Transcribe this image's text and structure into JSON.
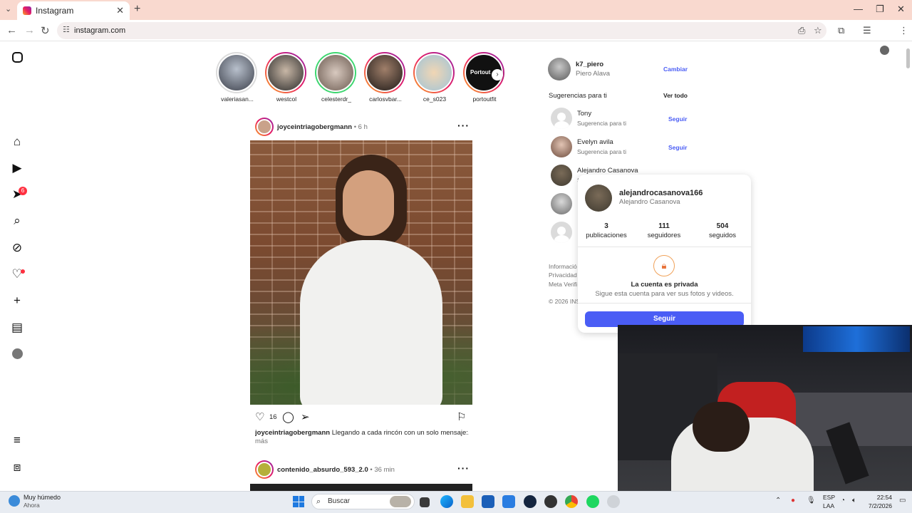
{
  "browser": {
    "tab_title": "Instagram",
    "url": "instagram.com"
  },
  "stories": [
    {
      "label": "valeriasan..."
    },
    {
      "label": "westcol"
    },
    {
      "label": "celesterdr_"
    },
    {
      "label": "carlosvbar..."
    },
    {
      "label": "ce_s023"
    },
    {
      "label": "portoutfit"
    }
  ],
  "story_thumb_text": "Portout",
  "nav": {
    "notification_count": "6"
  },
  "post1": {
    "username": "joyceintriagobergmann",
    "time": "6 h",
    "likes": "16",
    "caption_user": "joyceintriagobergmann",
    "caption_text": "Llegando a cada rincón con un solo mensaje:...",
    "more": "más"
  },
  "post2": {
    "username": "contenido_absurdo_593_2.0",
    "time": "36 min"
  },
  "sidebar": {
    "me_username": "k7_piero",
    "me_name": "Piero Alava",
    "switch_label": "Cambiar",
    "suggestions_title": "Sugerencias para ti",
    "see_all": "Ver todo",
    "follow_label": "Seguir",
    "suggestions": [
      {
        "name": "Tony",
        "sub": "Sugerencia para ti"
      },
      {
        "name": "Evelyn avila",
        "sub": "Sugerencia para ti"
      },
      {
        "name": "Alejandro Casanova",
        "sub": "S"
      }
    ],
    "footer_1": "Informació",
    "footer_2": "Privacidad ·",
    "footer_3": "Meta Verifi",
    "copyright": "© 2026 INS"
  },
  "hovercard": {
    "username": "alejandrocasanova166",
    "name": "Alejandro Casanova",
    "stats": [
      {
        "value": "3",
        "label": "publicaciones"
      },
      {
        "value": "111",
        "label": "seguidores"
      },
      {
        "value": "504",
        "label": "seguidos"
      }
    ],
    "private_title": "La cuenta es privada",
    "private_sub": "Sigue esta cuenta para ver sus fotos y videos.",
    "follow_button": "Seguir"
  },
  "taskbar": {
    "weather_title": "Muy húmedo",
    "weather_sub": "Ahora",
    "search_placeholder": "Buscar",
    "lang_1": "ESP",
    "lang_2": "LAA",
    "time": "22:54",
    "date": "7/2/2026"
  }
}
